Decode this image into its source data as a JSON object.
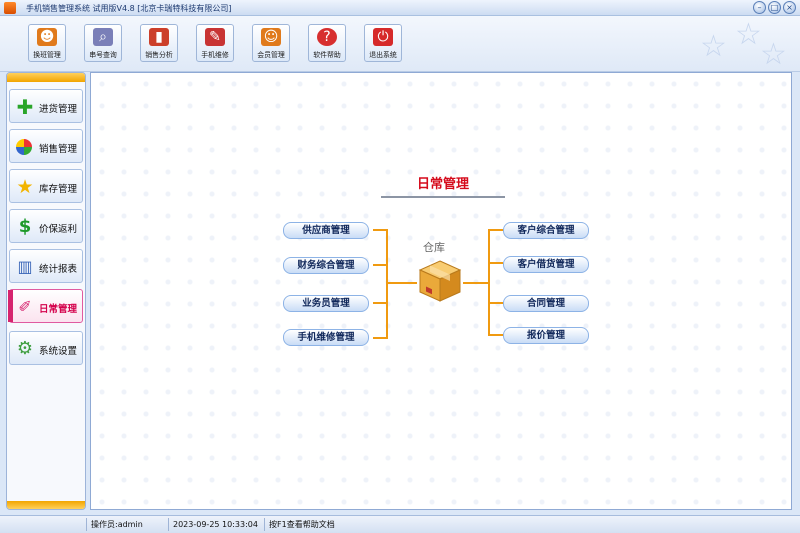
{
  "window": {
    "title": "手机销售管理系统 试用版V4.8 [北京卡瑞特科技有限公司]",
    "buttons": {
      "minimize": "–",
      "maximize": "□",
      "close": "×"
    }
  },
  "toolbar": {
    "items": [
      {
        "label": "换班管理",
        "icon": "person-swap-icon",
        "color": "#e07a1c"
      },
      {
        "label": "串号查询",
        "icon": "magnifier-icon",
        "color": "#7a7fb8"
      },
      {
        "label": "销售分析",
        "icon": "bar-chart-icon",
        "color": "#cc3f2a"
      },
      {
        "label": "手机维修",
        "icon": "screwdriver-icon",
        "color": "#c83434"
      },
      {
        "label": "会员管理",
        "icon": "members-icon",
        "color": "#e07a1c"
      },
      {
        "label": "软件帮助",
        "icon": "help-icon",
        "color": "#d72f2f"
      },
      {
        "label": "退出系统",
        "icon": "power-icon",
        "color": "#d62a2a"
      }
    ]
  },
  "sidebar": {
    "items": [
      {
        "label": "进货管理",
        "icon": "plus-icon",
        "active": false
      },
      {
        "label": "销售管理",
        "icon": "globe-icon",
        "active": false
      },
      {
        "label": "库存管理",
        "icon": "star-icon",
        "active": false
      },
      {
        "label": "价保返利",
        "icon": "dollar-icon",
        "active": false
      },
      {
        "label": "统计报表",
        "icon": "report-icon",
        "active": false
      },
      {
        "label": "日常管理",
        "icon": "brush-icon",
        "active": true
      },
      {
        "label": "系统设置",
        "icon": "gear-icon",
        "active": false
      }
    ]
  },
  "main": {
    "heading": "日常管理",
    "center_label": "仓库",
    "left_nodes": [
      "供应商管理",
      "财务综合管理",
      "业务员管理",
      "手机维修管理"
    ],
    "right_nodes": [
      "客户综合管理",
      "客户借货管理",
      "合同管理",
      "报价管理"
    ]
  },
  "statusbar": {
    "blank": "",
    "operator": "操作员:admin",
    "datetime": "2023-09-25 10:33:04",
    "hint": "按F1查看帮助文档"
  },
  "colors": {
    "accent": "#f2a500",
    "heading": "#d50a1b",
    "connector": "#f09a10",
    "active_nav": "#d4004b"
  }
}
